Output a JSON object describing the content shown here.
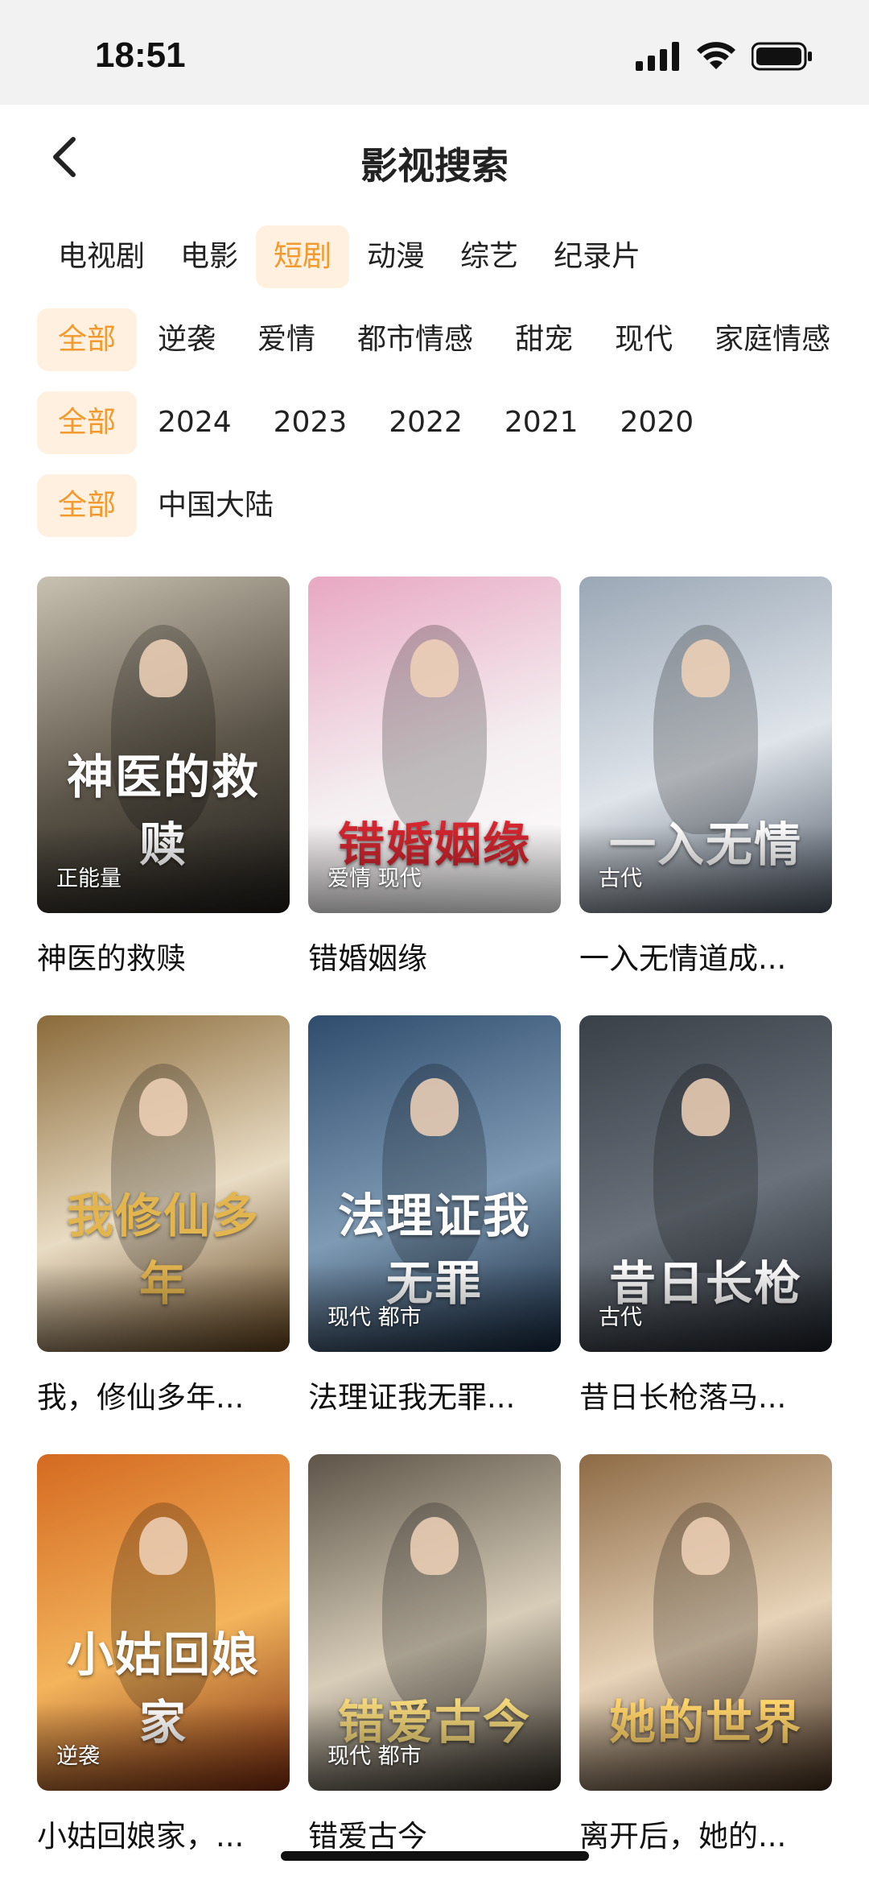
{
  "status_bar": {
    "time": "18:51",
    "icons": [
      "signal-icon",
      "wifi-icon",
      "battery-icon"
    ]
  },
  "nav": {
    "title": "影视搜索",
    "back_icon": "chevron-left-icon"
  },
  "category_tabs": [
    {
      "label": "电视剧",
      "active": false
    },
    {
      "label": "电影",
      "active": false
    },
    {
      "label": "短剧",
      "active": true
    },
    {
      "label": "动漫",
      "active": false
    },
    {
      "label": "综艺",
      "active": false
    },
    {
      "label": "纪录片",
      "active": false
    }
  ],
  "genre_filters": [
    "全部",
    "逆袭",
    "爱情",
    "都市情感",
    "甜宠",
    "现代",
    "家庭情感"
  ],
  "year_filters": [
    "全部",
    "2024",
    "2023",
    "2022",
    "2021",
    "2020"
  ],
  "region_filters": [
    "全部",
    "中国大陆"
  ],
  "colors": {
    "accent": "#f29a2e",
    "accent_bg": "#fff0df"
  },
  "results": [
    {
      "title": "神医的救赎",
      "tag": "正能量",
      "poster_text": "神医的救赎",
      "palette": [
        "#c9c1b1",
        "#5a5347",
        "#1e1c19"
      ],
      "ink": "#ffffff"
    },
    {
      "title": "错婚姻缘",
      "tag": "爱情 现代",
      "poster_text": "错婚姻缘",
      "palette": [
        "#e8a7c2",
        "#f4eef0",
        "#ffffff"
      ],
      "ink": "#d6262f"
    },
    {
      "title": "一入无情道成...",
      "tag": "古代",
      "poster_text": "一入无情",
      "palette": [
        "#9aa7b5",
        "#dfe4ea",
        "#4d5663"
      ],
      "ink": "#ffffff"
    },
    {
      "title": "我，修仙多年...",
      "tag": "",
      "poster_text": "我修仙多年",
      "palette": [
        "#8a6a3a",
        "#e9dcc4",
        "#5b3d19"
      ],
      "ink": "#e3b54f"
    },
    {
      "title": "法理证我无罪...",
      "tag": "现代 都市",
      "poster_text": "法理证我无罪",
      "palette": [
        "#2f4c6d",
        "#7e9ab4",
        "#14253a"
      ],
      "ink": "#ffffff"
    },
    {
      "title": "昔日长枪落马...",
      "tag": "古代",
      "poster_text": "昔日长枪",
      "palette": [
        "#3a4048",
        "#6a717a",
        "#1b1f25"
      ],
      "ink": "#ffffff"
    },
    {
      "title": "小姑回娘家，...",
      "tag": "逆袭",
      "poster_text": "小姑回娘家",
      "palette": [
        "#d46a21",
        "#f3b45c",
        "#7a2a0d"
      ],
      "ink": "#ffffff"
    },
    {
      "title": "错爱古今",
      "tag": "现代 都市",
      "poster_text": "错爱古今",
      "palette": [
        "#5d5448",
        "#d8cdb9",
        "#2f2a24"
      ],
      "ink": "#f3d67a"
    },
    {
      "title": "离开后，她的...",
      "tag": "",
      "poster_text": "她的世界",
      "palette": [
        "#8d6a45",
        "#e7d3b8",
        "#3e2a1a"
      ],
      "ink": "#ffd36b"
    }
  ]
}
